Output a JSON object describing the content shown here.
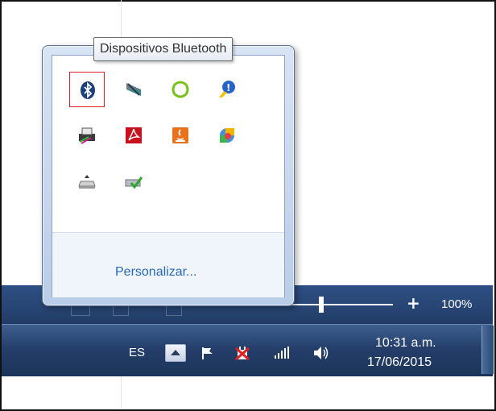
{
  "tooltip": {
    "text": "Dispositivos Bluetooth"
  },
  "overflow_popup": {
    "customize_label": "Personalizar...",
    "icons": [
      {
        "name": "bluetooth-icon",
        "selected": true
      },
      {
        "name": "network-sync-icon"
      },
      {
        "name": "green-ring-icon"
      },
      {
        "name": "help-balloon-icon"
      },
      {
        "name": "printer-icon"
      },
      {
        "name": "acrobat-icon"
      },
      {
        "name": "java-icon"
      },
      {
        "name": "color-app-icon"
      },
      {
        "name": "drive-icon"
      },
      {
        "name": "check-drive-icon"
      }
    ]
  },
  "statusbar": {
    "zoom_plus": "+",
    "zoom_percent": "100%"
  },
  "taskbar": {
    "language": "ES",
    "tray_icons": [
      "show-hidden-icons-icon",
      "action-center-flag-icon",
      "power-plug-icon",
      "signal-icon",
      "volume-icon"
    ],
    "clock": {
      "time": "10:31 a.m.",
      "date": "17/06/2015"
    }
  },
  "colors": {
    "taskbar": "#1f3a63",
    "link": "#2868b6",
    "selection": "#e02020"
  }
}
